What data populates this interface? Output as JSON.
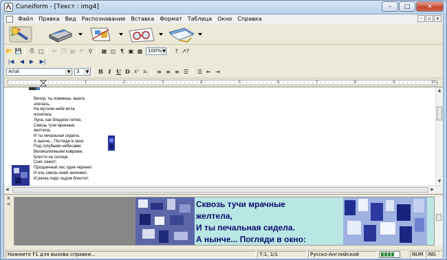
{
  "window": {
    "title": "Cuneiform - [Текст : img4]",
    "caption": {
      "minimize": "–",
      "maximize": "□",
      "close": "✕"
    }
  },
  "menu": {
    "items": [
      "Файл",
      "Правка",
      "Вид",
      "Распознавание",
      "Вставка",
      "Формат",
      "Таблица",
      "Окно",
      "Справка"
    ],
    "mdi": {
      "minimize": "-",
      "restore": "▫",
      "close": "x"
    }
  },
  "toolbar_big": [
    {
      "name": "scan-wand-tool",
      "icon": "wand-icon",
      "has_dropdown": false
    },
    {
      "name": "scanner-tool",
      "icon": "scanner-icon",
      "has_dropdown": true
    },
    {
      "name": "layout-tool",
      "icon": "layout-icon",
      "has_dropdown": true
    },
    {
      "name": "recognize-tool",
      "icon": "glasses-icon",
      "has_dropdown": true
    },
    {
      "name": "export-tool",
      "icon": "export-icon",
      "has_dropdown": true
    }
  ],
  "toolbar_standard": {
    "zoom": "100%",
    "icons": [
      "open-icon",
      "save-icon",
      "print-icon",
      "print-preview-icon",
      "cut-icon",
      "copy-icon",
      "paste-icon",
      "undo-icon",
      "find-icon",
      "table-icon",
      "columns-icon",
      "paragraph-icon",
      "frame-icon",
      "image-icon",
      "help-icon",
      "context-help-icon"
    ]
  },
  "toolbar_nav": {
    "icons": [
      "first-page-icon",
      "prev-page-icon",
      "next-page-icon",
      "last-page-icon"
    ],
    "glyphs": [
      "|◀",
      "◀",
      "▶",
      "▶|"
    ]
  },
  "toolbar_format": {
    "font": "Arial",
    "size": "3",
    "bold": "B",
    "italic": "I",
    "underline": "U",
    "strike": "D",
    "superscript": "x²",
    "subscript": "x₂"
  },
  "document": {
    "lines": [
      "Вечор, ты помнишь, вьюга",
      "злилась,",
      "На мутном небе мгла",
      "носилась;",
      "Луна, как бледное пятно,",
      "Сквозь тучи мрачные",
      "желтела,",
      "И ты печальная сидела.",
      "А нынче... Погляди в окно:",
      "Под голубыми небесами",
      "Великолепными коврами,",
      "Блестя на солнце,",
      "Снег лежит;",
      "Прозрачный лес один чернеет",
      "И ель сквозь иней зеленеет,",
      "И речка подо льдом блестит."
    ]
  },
  "image_preview": {
    "lines": [
      "Сквозь тучи мрачные",
      "желтела,",
      "И ты печальная сидела.",
      "А нынче... Погляди в окно:"
    ],
    "controls": [
      "x",
      "<"
    ],
    "text_color": "#0a0a6e",
    "background_color": "#b9e7e4"
  },
  "statusbar": {
    "help": "Нажмите F1 для вызова справки...",
    "position": "7:1, 1/1",
    "language": "Русско-Английский",
    "num": "NUM",
    "ins": "INS"
  }
}
